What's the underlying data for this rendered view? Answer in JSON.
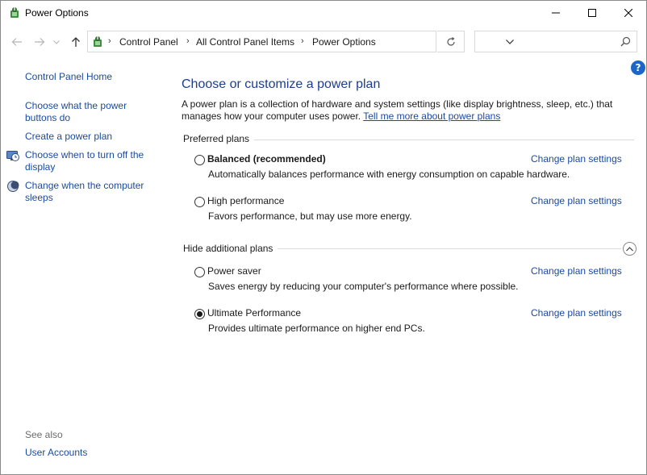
{
  "window": {
    "title": "Power Options"
  },
  "address": {
    "crumbs": [
      "Control Panel",
      "All Control Panel Items",
      "Power Options"
    ],
    "search_placeholder": ""
  },
  "sidebar": {
    "home": "Control Panel Home",
    "items": [
      {
        "label_1": "Choose what the power",
        "label_2": "buttons do"
      },
      {
        "label_1": "Create a power plan",
        "label_2": ""
      },
      {
        "label_1": "Choose when to turn off the",
        "label_2": "display",
        "icon": "display-timer-icon"
      },
      {
        "label_1": "Change when the computer",
        "label_2": "sleeps",
        "icon": "sleep-moon-icon"
      }
    ],
    "see_also": "See also",
    "user_accounts": "User Accounts"
  },
  "main": {
    "heading": "Choose or customize a power plan",
    "desc_line1": "A power plan is a collection of hardware and system settings (like display brightness, sleep, etc.) that",
    "desc_line2": "manages how your computer uses power.",
    "learn_more": "Tell me more about power plans",
    "preferred_label": "Preferred plans",
    "hide_label": "Hide additional plans",
    "change_label": "Change plan settings",
    "plans": [
      {
        "name": "Balanced (recommended)",
        "desc": "Automatically balances performance with energy consumption on capable hardware.",
        "selected": false
      },
      {
        "name": "High performance",
        "desc": "Favors performance, but may use more energy.",
        "selected": false
      },
      {
        "name": "Power saver",
        "desc": "Saves energy by reducing your computer's performance where possible.",
        "selected": false
      },
      {
        "name": "Ultimate Performance",
        "desc": "Provides ultimate performance on higher end PCs.",
        "selected": true
      }
    ]
  },
  "colors": {
    "link": "#1a4ba0",
    "heading": "#1e3d8f",
    "help": "#1c66c7"
  }
}
